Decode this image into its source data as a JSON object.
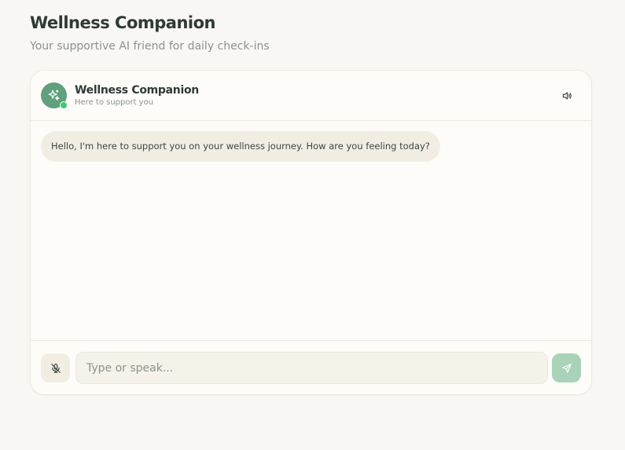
{
  "page": {
    "title": "Wellness Companion",
    "subtitle": "Your supportive AI friend for daily check-ins"
  },
  "chat": {
    "header": {
      "name": "Wellness Companion",
      "status": "Here to support you",
      "avatar_icon": "sparkle-icon",
      "speaker_icon": "speaker-icon"
    },
    "messages": [
      {
        "sender": "assistant",
        "text": "Hello, I'm here to support you on your wellness journey. How are you feeling today?"
      }
    ],
    "composer": {
      "placeholder": "Type or speak...",
      "value": "",
      "mic_icon": "mic-off-icon",
      "send_icon": "send-icon"
    }
  },
  "colors": {
    "accent": "#5fa07d",
    "online": "#3dcc6c",
    "send_button": "#a8d3b8",
    "bubble": "#f1ede3",
    "background": "#f8f7f3"
  }
}
